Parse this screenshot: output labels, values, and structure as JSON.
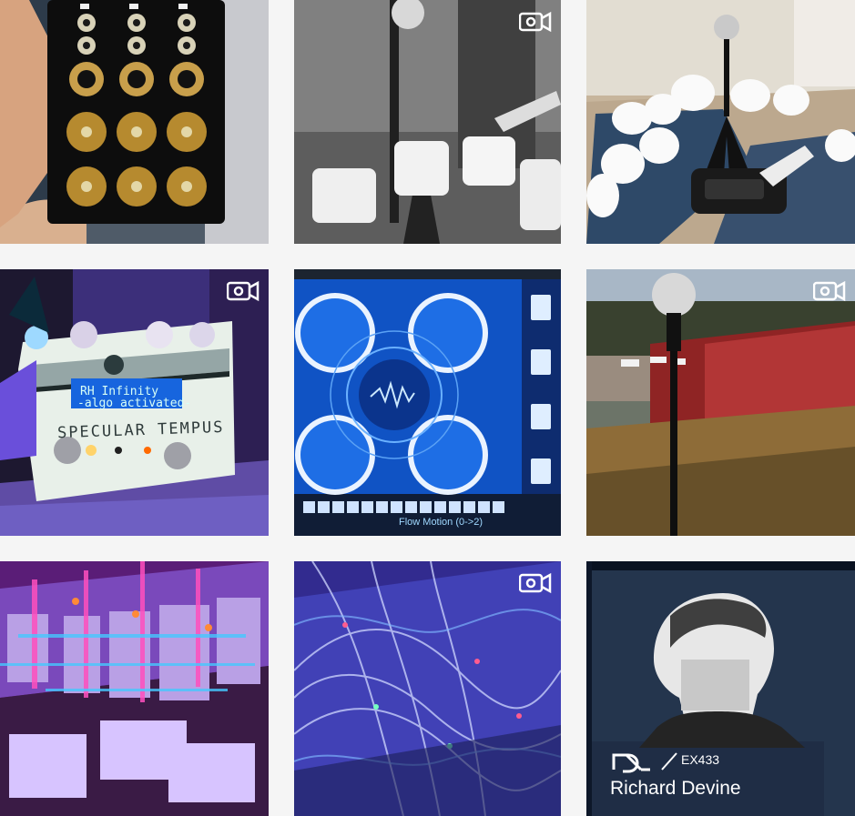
{
  "gallery": {
    "tiles": [
      {
        "id": "eurorack-module-in-hand",
        "has_video": false
      },
      {
        "id": "crystal-bowls-bw",
        "has_video": true
      },
      {
        "id": "crystal-bowls-recorder",
        "has_video": false
      },
      {
        "id": "specular-tempus-pedal",
        "has_video": true,
        "lcd_line_1": "RH Infinity",
        "lcd_line_2": "-algo activated-",
        "pedal_name": "SPECULAR TEMPUS"
      },
      {
        "id": "flow-motion-ui",
        "has_video": false,
        "caption": "Flow Motion (0->2)"
      },
      {
        "id": "mic-on-hay-bale",
        "has_video": true
      },
      {
        "id": "modular-wall",
        "has_video": false
      },
      {
        "id": "purple-cables",
        "has_video": true
      },
      {
        "id": "ra-exchange-portrait",
        "has_video": false,
        "code": "EX433",
        "name": "Richard Devine"
      }
    ]
  },
  "colors": {
    "page_background": "#f5f5f5",
    "video_icon": "#ffffff",
    "ra_panel": "#24354d"
  },
  "icons": {
    "video": "video-camera-icon",
    "ra_logo": "resident-advisor-logo-icon"
  }
}
